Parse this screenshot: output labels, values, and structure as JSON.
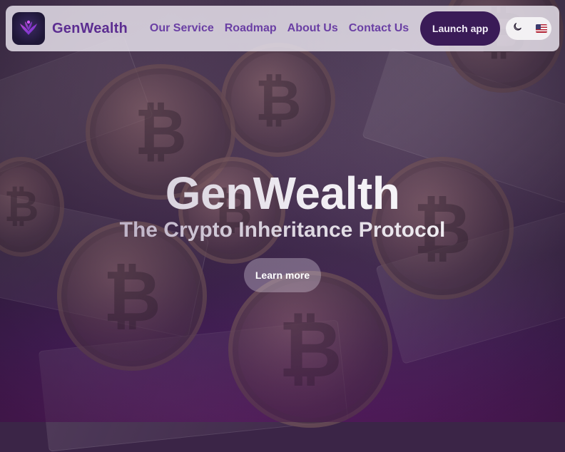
{
  "nav": {
    "brand": "GenWealth",
    "links": [
      "Our Service",
      "Roadmap",
      "About Us",
      "Contact Us"
    ],
    "launch_label": "Launch app",
    "theme_icon": "moon-icon",
    "language_icon": "us-flag-icon"
  },
  "hero": {
    "title": "GenWealth",
    "subtitle": "The Crypto Inheritance Protocol",
    "cta_label": "Learn more"
  },
  "colors": {
    "brand_purple": "#5c2d91",
    "nav_link": "#6a3fa4",
    "launch_bg": "#3a1b57"
  }
}
